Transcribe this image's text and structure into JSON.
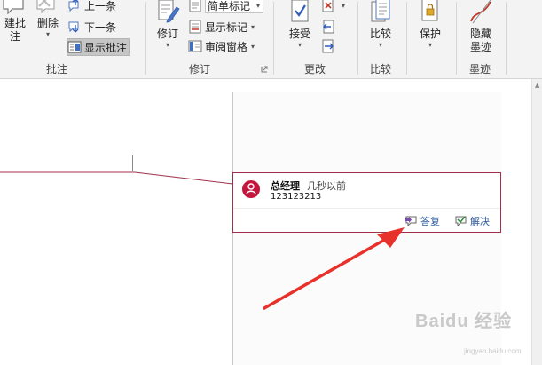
{
  "ribbon": {
    "comments_group": {
      "new_label": "建批注",
      "delete_label": "删除",
      "previous_label": "上一条",
      "next_label": "下一条",
      "show_comments_label": "显示批注",
      "group_label": "批注"
    },
    "tracking_group": {
      "track_changes_label": "修订",
      "markup_combo_value": "简单标记",
      "show_markup_label": "显示标记",
      "review_pane_label": "审阅窗格",
      "group_label": "修订"
    },
    "changes_group": {
      "accept_label": "接受",
      "group_label": "更改"
    },
    "compare_group": {
      "compare_label": "比较",
      "group_label": "比较"
    },
    "protect_group": {
      "protect_label": "保护"
    },
    "ink_group": {
      "hide_ink_label_line1": "隐藏",
      "hide_ink_label_line2": "墨迹",
      "group_label": "墨迹"
    }
  },
  "comment": {
    "author": "总经理",
    "time": "几秒以前",
    "text": "123123213",
    "reply_label": "答复",
    "resolve_label": "解决",
    "border_color": "#a0304a",
    "avatar_color": "#c4153c"
  },
  "annotation": {
    "arrow_color": "#e8312a"
  },
  "watermark": {
    "logo_text": "Baidu 经验",
    "url_text": "jingyan.baidu.com"
  }
}
